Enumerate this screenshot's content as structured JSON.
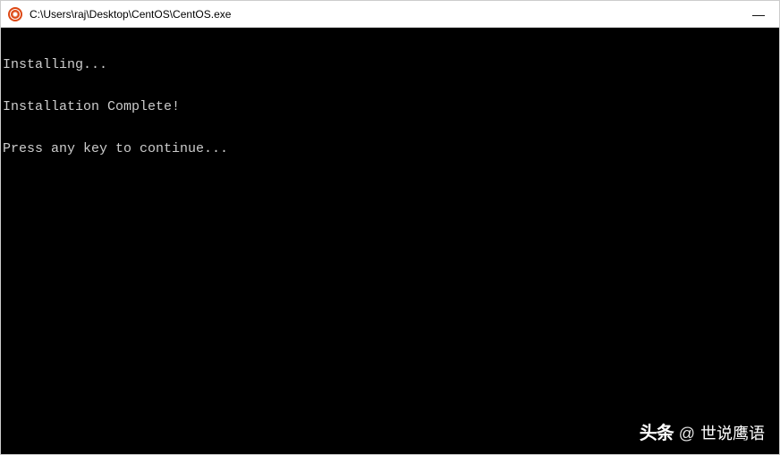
{
  "window": {
    "title": "C:\\Users\\raj\\Desktop\\CentOS\\CentOS.exe",
    "controls": {
      "minimize": "—"
    }
  },
  "console": {
    "lines": [
      "Installing...",
      "Installation Complete!",
      "Press any key to continue..."
    ]
  },
  "watermark": {
    "brand": "头条",
    "at": "@",
    "author": "世说鹰语"
  }
}
